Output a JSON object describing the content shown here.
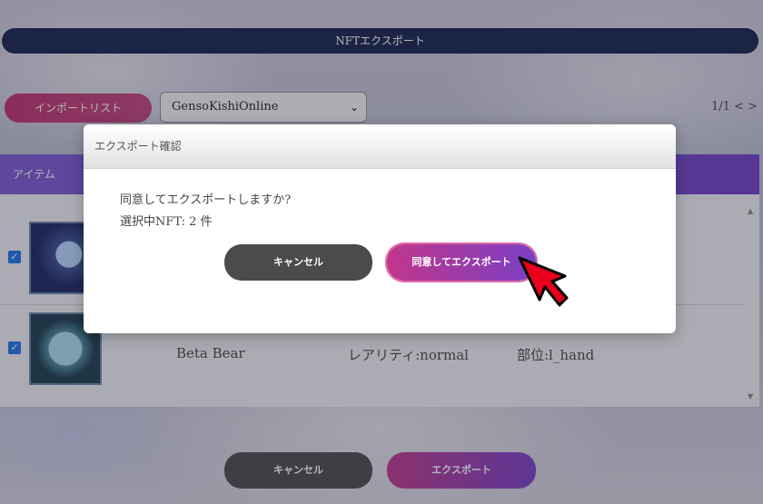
{
  "header": {
    "title": "NFTエクスポート"
  },
  "toolbar": {
    "import_list_label": "インポートリスト",
    "game_select_value": "GensoKishiOnline",
    "pager": "1/1 < >"
  },
  "list": {
    "column_item": "アイテム",
    "rows": [
      {
        "checked": true
      },
      {
        "checked": true,
        "name": "Beta Bear",
        "rarity": "レアリティ:normal",
        "part": "部位:l_hand"
      }
    ]
  },
  "footer": {
    "cancel_label": "キャンセル",
    "export_label": "エクスポート"
  },
  "modal": {
    "title": "エクスポート確認",
    "message": "同意してエクスポートしますか?",
    "selected_count": "選択中NFT: 2 件",
    "cancel_label": "キャンセル",
    "confirm_label": "同意してエクスポート"
  },
  "colors": {
    "header_bg": "#14234a",
    "accent_pink": "#c0306a",
    "accent_purple": "#7a3fc5",
    "list_header": "#7d59d2",
    "cancel_button": "#4b4b4b",
    "cursor": "#e8001c"
  }
}
